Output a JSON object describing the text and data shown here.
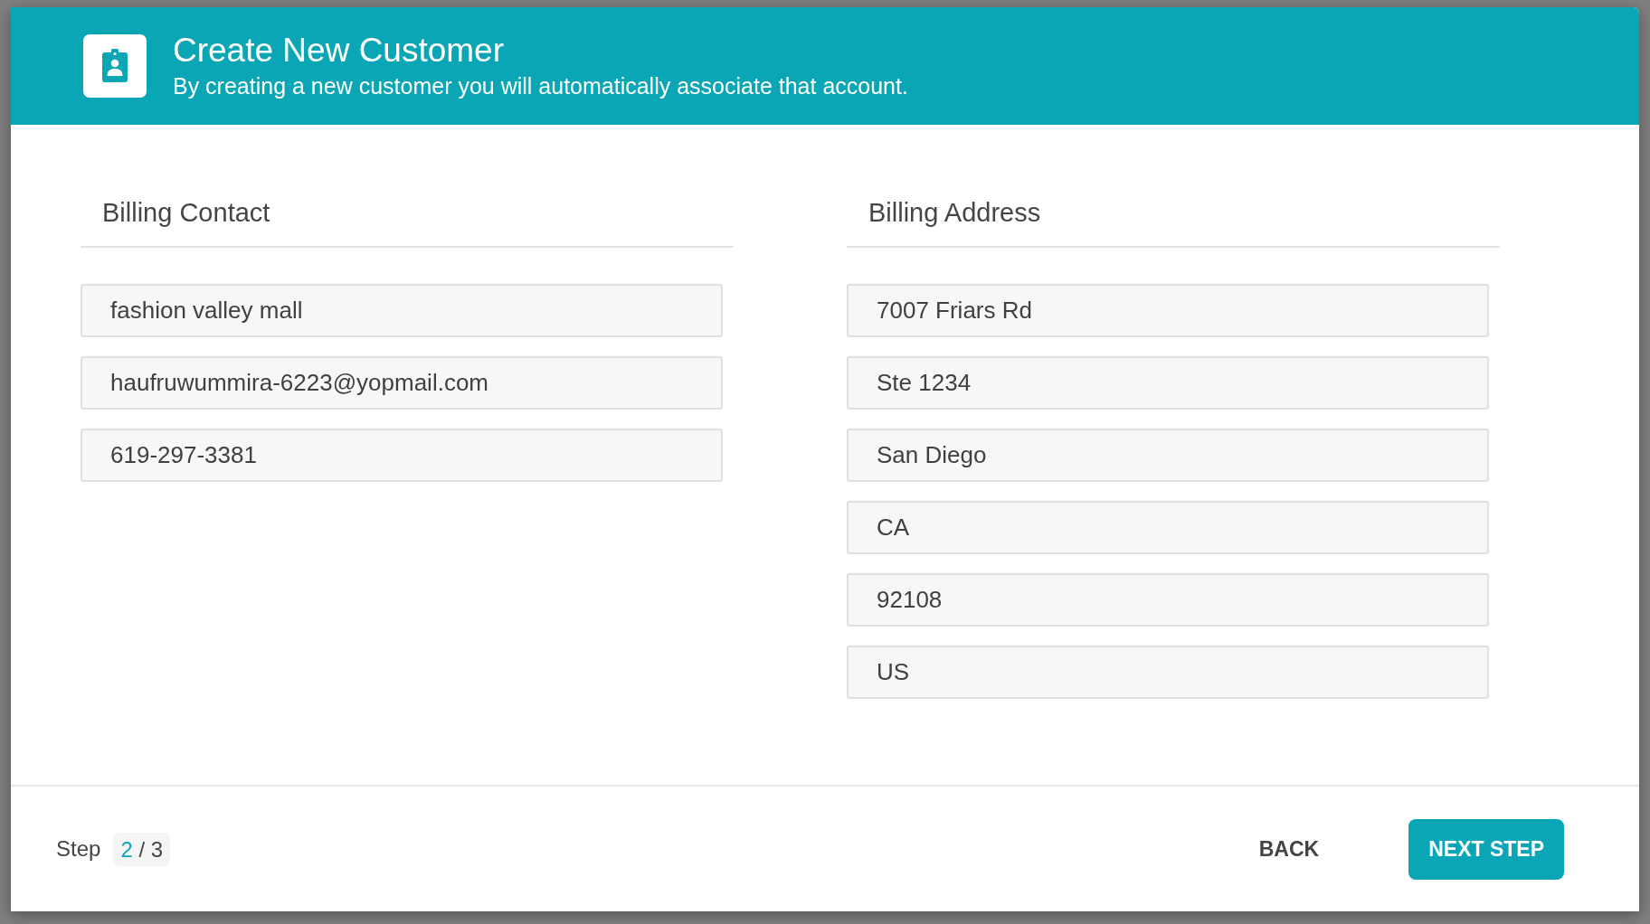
{
  "dialog": {
    "title": "Create New Customer",
    "subtitle": "By creating a new customer you will automatically associate that account.",
    "sections": [
      {
        "heading": "Billing Contact",
        "fields": [
          {
            "value": "fashion valley mall"
          },
          {
            "value": "haufruwummira-6223@yopmail.com"
          },
          {
            "value": "619-297-3381"
          }
        ]
      },
      {
        "heading": "Billing Address",
        "fields": [
          {
            "value": "7007 Friars Rd"
          },
          {
            "value": "Ste 1234"
          },
          {
            "value": "San Diego"
          },
          {
            "value": "CA"
          },
          {
            "value": "92108"
          },
          {
            "value": "US"
          }
        ]
      }
    ],
    "footer": {
      "step_label": "Step",
      "step_current": "2",
      "step_separator": "/",
      "step_total": "3",
      "buttons": [
        {
          "label": "BACK",
          "kind": "text"
        },
        {
          "label": "NEXT STEP",
          "kind": "primary"
        }
      ]
    }
  }
}
